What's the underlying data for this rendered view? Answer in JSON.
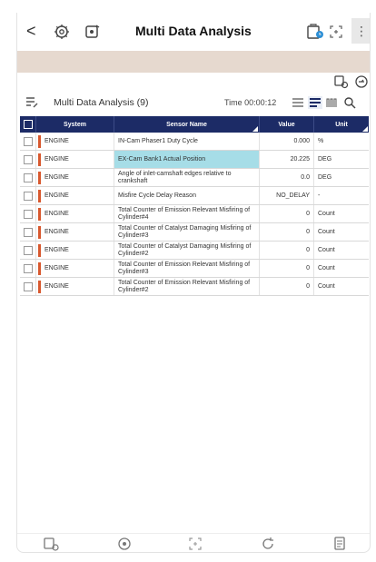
{
  "header": {
    "title": "Multi Data Analysis",
    "back_glyph": "<",
    "more_glyph": "⋮",
    "icons": [
      "engine-settings-icon",
      "record-icon",
      "freeze-frame-icon",
      "expand-icon"
    ]
  },
  "subtoolbar": {
    "icons": [
      "graph-settings-icon",
      "gauge-icon"
    ]
  },
  "info": {
    "title": "Multi Data Analysis (9)",
    "time": "Time 00:00:12",
    "view_icons": [
      "list-view-icon",
      "detail-view-icon",
      "graph-view-icon",
      "search-icon"
    ]
  },
  "table": {
    "headers": [
      "System",
      "Sensor Name",
      "Value",
      "Unit"
    ],
    "rows": [
      {
        "system": "ENGINE",
        "name": "IN-Cam Phaser1 Duty Cycle",
        "value": "0.000",
        "unit": "%"
      },
      {
        "system": "ENGINE",
        "name": "EX-Cam Bank1 Actual Position",
        "value": "20.225",
        "unit": "DEG"
      },
      {
        "system": "ENGINE",
        "name": "Angle of inlet-camshaft edges relative to crankshaft",
        "value": "0.0",
        "unit": "DEG"
      },
      {
        "system": "ENGINE",
        "name": "Misfire Cycle Delay Reason",
        "value": "NO_DELAY",
        "unit": "-"
      },
      {
        "system": "ENGINE",
        "name": "Total Counter of Emission Relevant Misfiring of Cylinder#4",
        "value": "0",
        "unit": "Count"
      },
      {
        "system": "ENGINE",
        "name": "Total Counter of Catalyst Damaging Misfiring of Cylinder#3",
        "value": "0",
        "unit": "Count"
      },
      {
        "system": "ENGINE",
        "name": "Total Counter of Catalyst Damaging Misfiring of Cylinder#2",
        "value": "0",
        "unit": "Count"
      },
      {
        "system": "ENGINE",
        "name": "Total Counter of Emission Relevant Misfiring of Cylinder#3",
        "value": "0",
        "unit": "Count"
      },
      {
        "system": "ENGINE",
        "name": "Total Counter of Emission Relevant Misfiring of Cylinder#2",
        "value": "0",
        "unit": "Count"
      }
    ],
    "selected_row": 1
  },
  "bottombar": {
    "icons": [
      "vehicle-graph-icon",
      "record-button-icon",
      "expand-icon",
      "refresh-icon",
      "report-icon"
    ]
  },
  "colors": {
    "header_bg": "#1c2b66",
    "band_bg": "#e6d9cf",
    "selected_cell": "#a6dde7",
    "system_marker": "#d8582e"
  }
}
